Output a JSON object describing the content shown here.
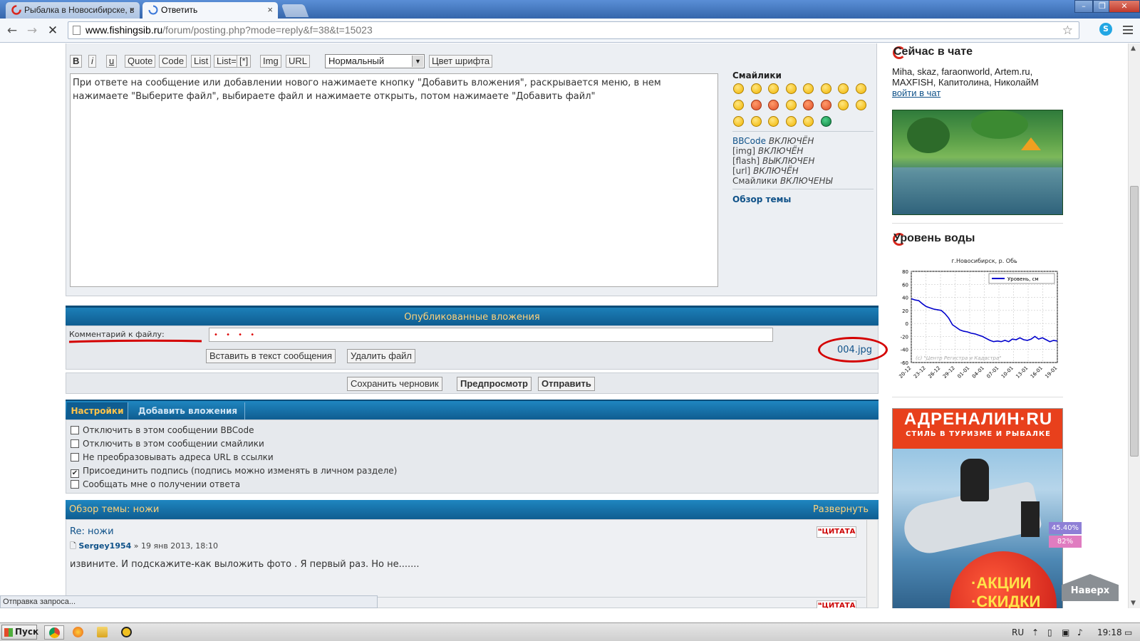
{
  "browser": {
    "tabs": [
      {
        "label": "Рыбалка в Новосибирске, в",
        "active": false
      },
      {
        "label": "Ответить",
        "active": true
      }
    ],
    "url_host": "www.fishingsib.ru",
    "url_path": "/forum/posting.php?mode=reply&f=38&t=15023",
    "status_text": "Отправка запроса..."
  },
  "editor": {
    "bbcode_buttons": [
      "B",
      "i",
      "u",
      "Quote",
      "Code",
      "List",
      "List=",
      "[*]",
      "Img",
      "URL"
    ],
    "font_size_select": "Нормальный",
    "font_color_button": "Цвет шрифта",
    "message_text": "При ответе на сообщение или добавлении нового нажимаете кнопку \"Добавить вложения\", раскрывается меню, в нем нажимаете \"Выберите файл\", выбираете файл и нажимаете открыть, потом нажимаете \"Добавить файл\"",
    "smileys_title": "Смайлики",
    "flags": {
      "bbcode_label": "BBCode",
      "bbcode_state": "ВКЛЮЧЁН",
      "img_label": "[img]",
      "img_state": "ВКЛЮЧЁН",
      "flash_label": "[flash]",
      "flash_state": "ВЫКЛЮЧЕН",
      "url_label": "[url]",
      "url_state": "ВКЛЮЧЁН",
      "smileys_label": "Смайлики",
      "smileys_state": "ВКЛЮЧЕНЫ"
    },
    "topic_overview_link": "Обзор темы"
  },
  "attachments": {
    "header": "Опубликованные вложения",
    "comment_label": "Комментарий к файлу:",
    "insert_button": "Вставить в текст сообщения",
    "delete_button": "Удалить файл",
    "filename": "004.jpg"
  },
  "submit": {
    "save_draft": "Сохранить черновик",
    "preview": "Предпросмотр",
    "send": "Отправить"
  },
  "options": {
    "tab_settings": "Настройки",
    "tab_add_attachments": "Добавить вложения",
    "items": [
      {
        "label": "Отключить в этом сообщении BBCode",
        "checked": false
      },
      {
        "label": "Отключить в этом сообщении смайлики",
        "checked": false
      },
      {
        "label": "Не преобразовывать адреса URL в ссылки",
        "checked": false
      },
      {
        "label": "Присоединить подпись (подпись можно изменять в личном разделе)",
        "checked": true
      },
      {
        "label": "Сообщать мне о получении ответа",
        "checked": false
      }
    ]
  },
  "review": {
    "title": "Обзор темы: ножи",
    "expand": "Развернуть",
    "post_title": "Re: ножи",
    "author": "Sergey1954",
    "date": "» 19 янв 2013, 18:10",
    "post_text": "извините. И подскажите-как выложить фото . Я первый раз. Но не.......",
    "quote_label": "ЦИТАТА"
  },
  "sidebar": {
    "chat_title": "Сейчас в чате",
    "chat_users": "Miha, skaz, faraonworld, Artem.ru, MAXFISH, Капитолина, НиколайМ",
    "chat_link": "войти в чат",
    "water_title": "Уровень воды",
    "ad_brand": "АДРЕНАЛИН·RU",
    "ad_tagline": "СТИЛЬ В ТУРИЗМЕ И РЫБАЛКЕ",
    "ad_promo": "·АКЦИИ ·СКИДКИ",
    "pct_1": "45.40%",
    "pct_2": "82%",
    "to_top": "Наверх"
  },
  "chart_data": {
    "type": "line",
    "title": "г.Новосибирск, р. Обь",
    "series": [
      {
        "name": "Уровень, см",
        "color": "#0000cc",
        "values": [
          38,
          36,
          35,
          30,
          26,
          24,
          22,
          21,
          20,
          15,
          8,
          -2,
          -6,
          -10,
          -12,
          -13,
          -15,
          -16,
          -18,
          -20,
          -23,
          -26,
          -28,
          -27,
          -28,
          -26,
          -28,
          -24,
          -25,
          -22,
          -25,
          -26,
          -24,
          -20,
          -24,
          -22,
          -25,
          -28,
          -26,
          -27
        ]
      }
    ],
    "x_ticks": [
      "20-12",
      "23-12",
      "26-12",
      "29-12",
      "01-01",
      "04-01",
      "07-01",
      "10-01",
      "13-01",
      "16-01",
      "19-01"
    ],
    "y_ticks": [
      80,
      60,
      40,
      20,
      0,
      -20,
      -40,
      -60
    ],
    "ylim": [
      -60,
      80
    ],
    "watermark": "(с) \"Центр Регистра и Кадастра\"",
    "grid": true
  },
  "taskbar": {
    "start": "Пуск",
    "lang": "RU",
    "clock": "19:18"
  }
}
